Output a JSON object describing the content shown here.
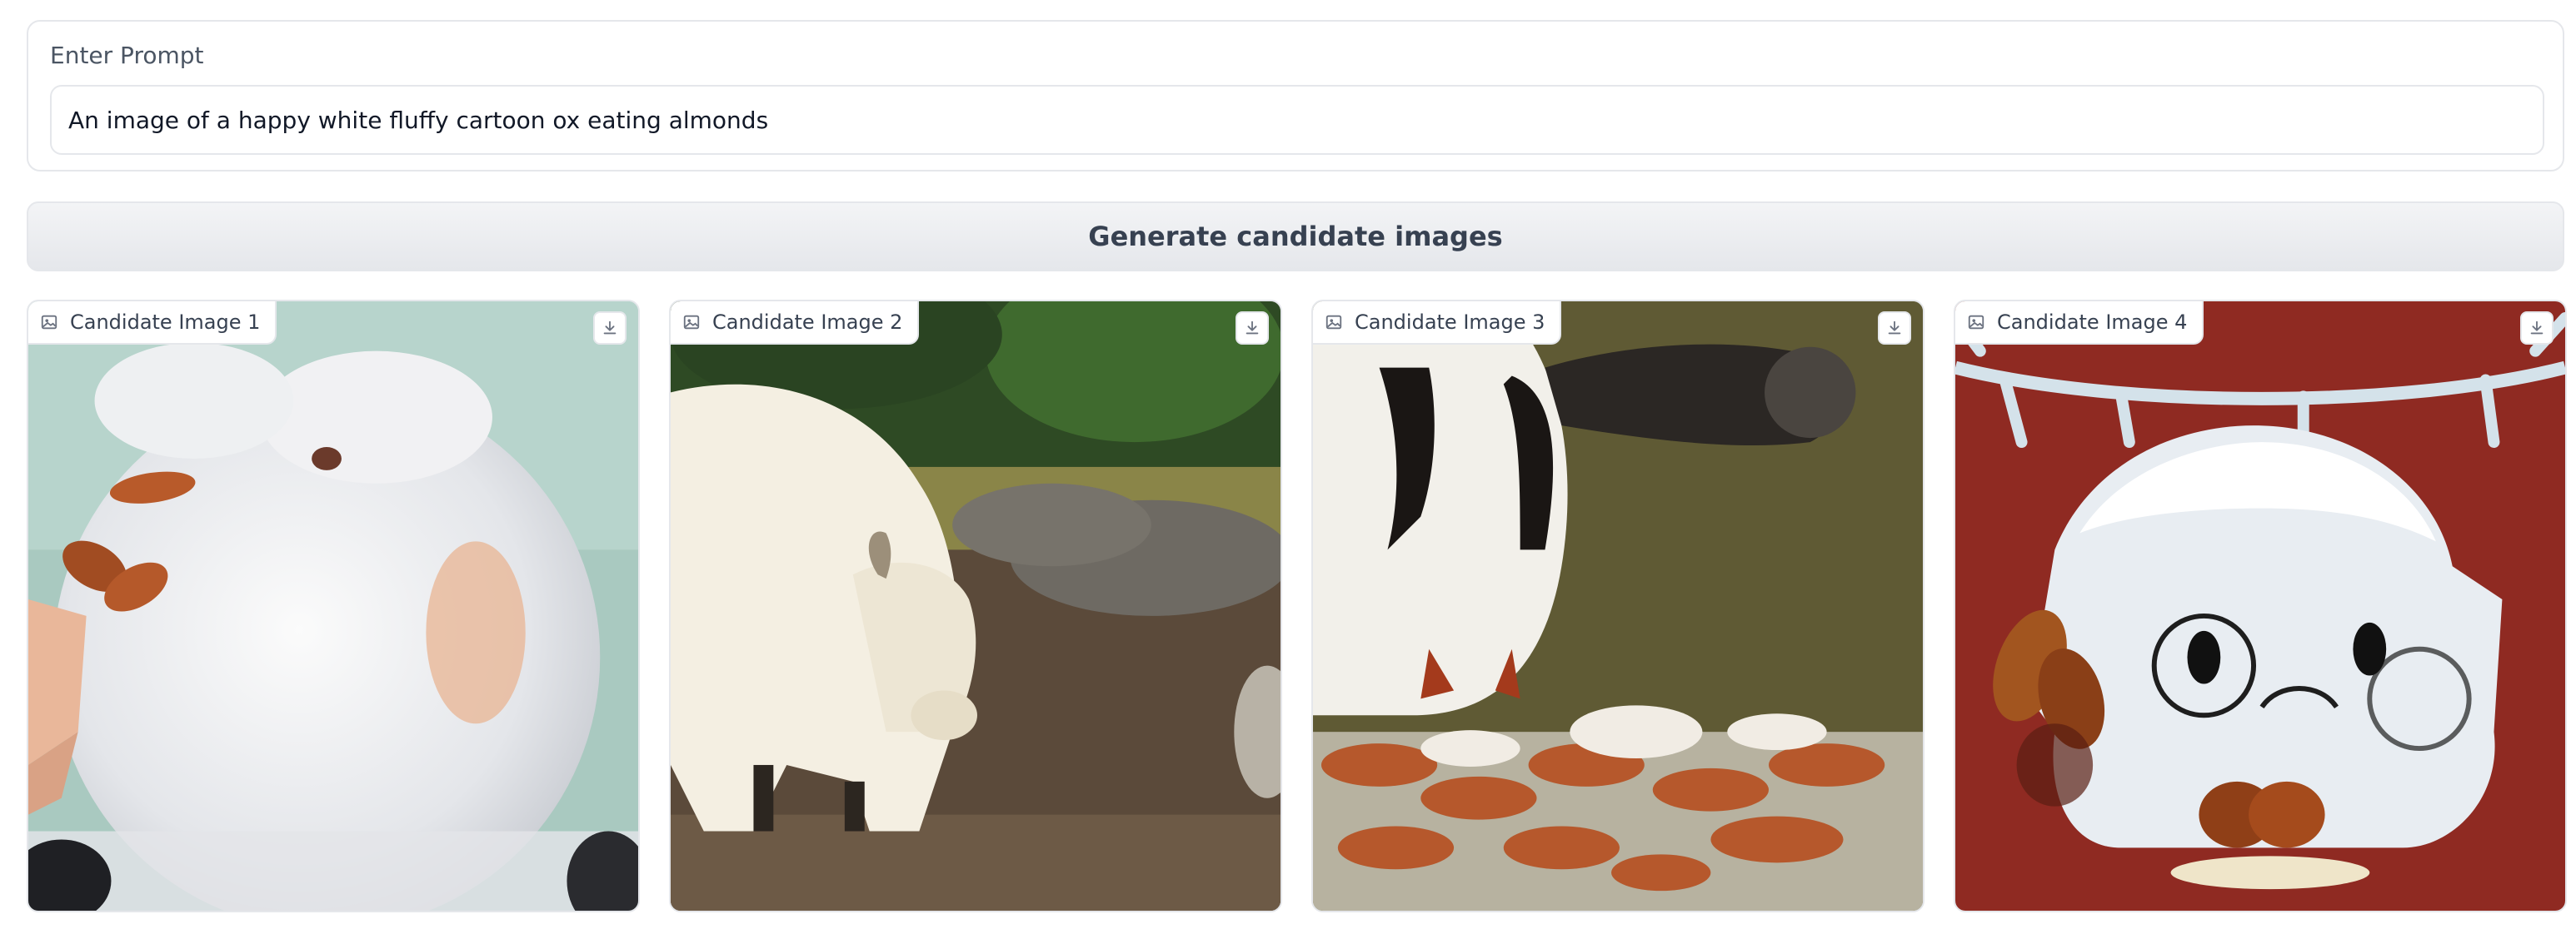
{
  "prompt": {
    "label": "Enter Prompt",
    "value": "An image of a happy white fluffy cartoon ox eating almonds"
  },
  "generate_button": {
    "label": "Generate candidate images"
  },
  "gallery": {
    "cards": [
      {
        "label": "Candidate Image 1"
      },
      {
        "label": "Candidate Image 2"
      },
      {
        "label": "Candidate Image 3"
      },
      {
        "label": "Candidate Image 4"
      }
    ]
  },
  "icons": {
    "image": "image-icon",
    "download": "download-icon"
  },
  "colors": {
    "border": "#e5e7eb",
    "button_bg": "#e5e7eb",
    "text": "#374151"
  }
}
